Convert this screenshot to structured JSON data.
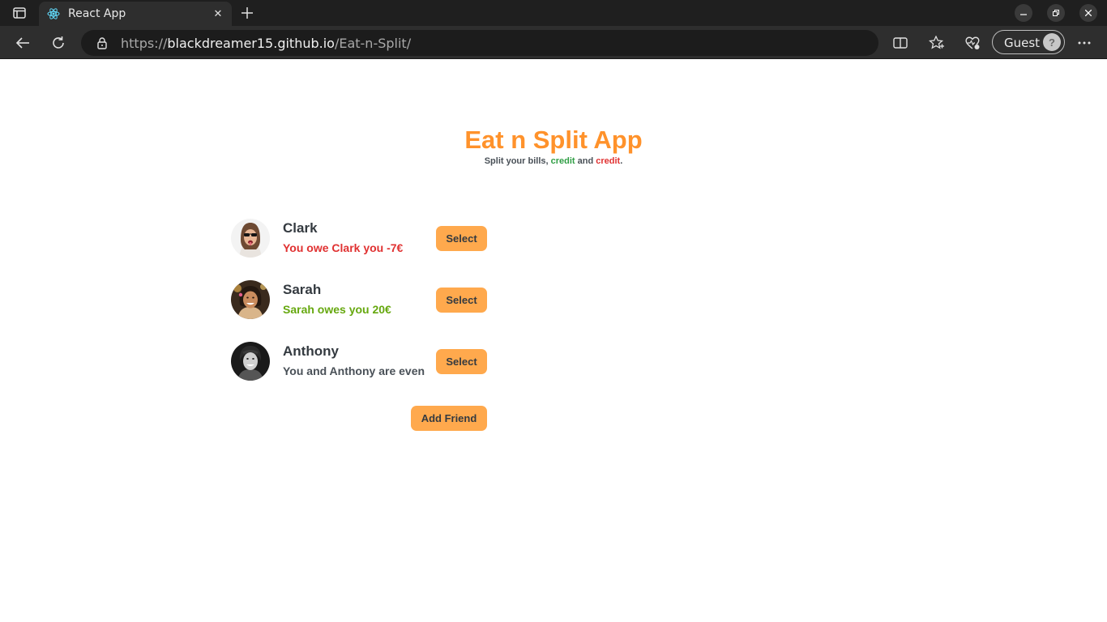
{
  "browser": {
    "tab_title": "React App",
    "url_scheme": "https://",
    "url_host": "blackdreamer15.github.io",
    "url_path": "/Eat-n-Split/",
    "profile_label": "Guest"
  },
  "app": {
    "title": "Eat n Split App",
    "subtitle_prefix": "Split your bills, ",
    "subtitle_word1": "credit",
    "subtitle_mid": " and ",
    "subtitle_word2": "credit",
    "subtitle_suffix": "."
  },
  "friends": [
    {
      "name": "Clark",
      "status": "You owe Clark you -7€",
      "status_color": "#e03131",
      "button": "Select"
    },
    {
      "name": "Sarah",
      "status": "Sarah owes you 20€",
      "status_color": "#66a80f",
      "button": "Select"
    },
    {
      "name": "Anthony",
      "status": "You and Anthony are even",
      "status_color": "#495057",
      "button": "Select"
    }
  ],
  "add_friend_label": "Add Friend",
  "colors": {
    "accent": "#ff922b",
    "button_bg": "#ffa94d"
  }
}
